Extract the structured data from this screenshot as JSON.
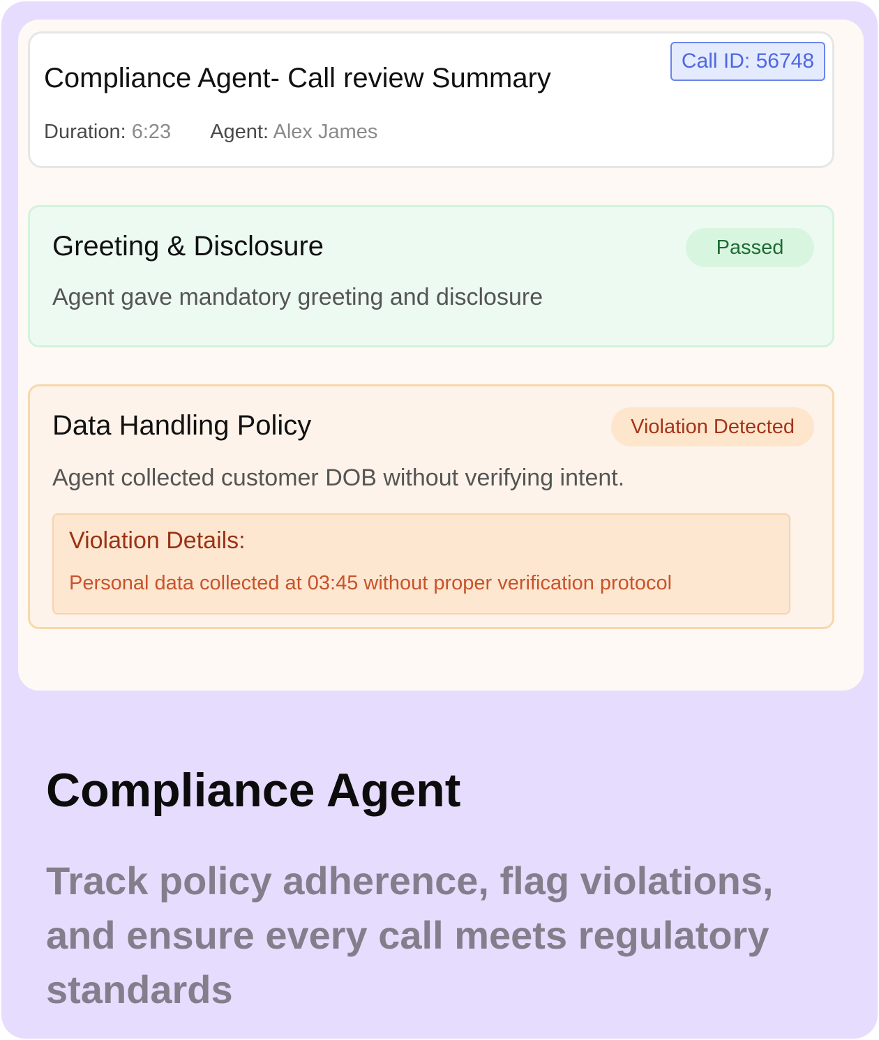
{
  "summary": {
    "title": "Compliance Agent- Call review Summary",
    "call_id": "Call ID: 56748",
    "duration_label": "Duration:",
    "duration_value": "6:23",
    "agent_label": "Agent:",
    "agent_value": "Alex James"
  },
  "checks": [
    {
      "title": "Greeting & Disclosure",
      "status": "Passed",
      "description": "Agent gave mandatory greeting and disclosure",
      "status_color": "#1e6b33",
      "card_bg": "#edfaf1"
    },
    {
      "title": "Data Handling Policy",
      "status": "Violation Detected",
      "description": "Agent collected customer DOB without verifying intent.",
      "status_color": "#a3341b",
      "card_bg": "#fdf3ea",
      "details_title": "Violation Details:",
      "details_text": "Personal data collected at 03:45 without proper verification protocol"
    }
  ],
  "feature": {
    "title": "Compliance Agent",
    "description": "Track policy adherence, flag violations, and ensure every call meets regulatory standards"
  },
  "colors": {
    "outer_bg": "#e6dcfd",
    "panel_bg": "#fef9f4",
    "accent_blue": "#4f67e0"
  }
}
